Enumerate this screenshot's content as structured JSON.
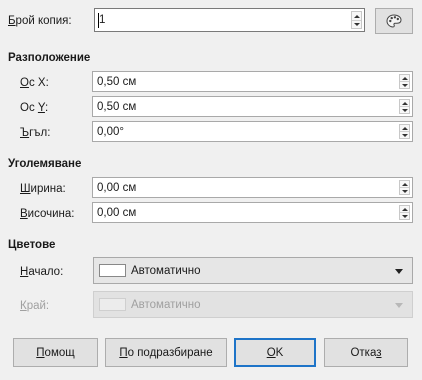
{
  "copies": {
    "label": "Брой копия:",
    "value": "1",
    "palette_icon": "palette-icon"
  },
  "placement": {
    "heading": "Разположение",
    "x_axis": {
      "label": "Ос X:",
      "value": "0,50 см"
    },
    "y_axis": {
      "label": "Ос Y:",
      "value": "0,50 см"
    },
    "angle": {
      "label": "Ъгъл:",
      "value": "0,00°"
    }
  },
  "enlargement": {
    "heading": "Уголемяване",
    "width": {
      "label": "Ширина:",
      "value": "0,00 см"
    },
    "height": {
      "label": "Височина:",
      "value": "0,00 см"
    }
  },
  "colors": {
    "heading": "Цветове",
    "start": {
      "label": "Начало:",
      "value": "Автоматично",
      "enabled": true
    },
    "end": {
      "label": "Край:",
      "value": "Автоматично",
      "enabled": false
    }
  },
  "buttons": {
    "help": "Помощ",
    "defaults": "По подразбиране",
    "ok": "OK",
    "cancel": "Отказ"
  }
}
